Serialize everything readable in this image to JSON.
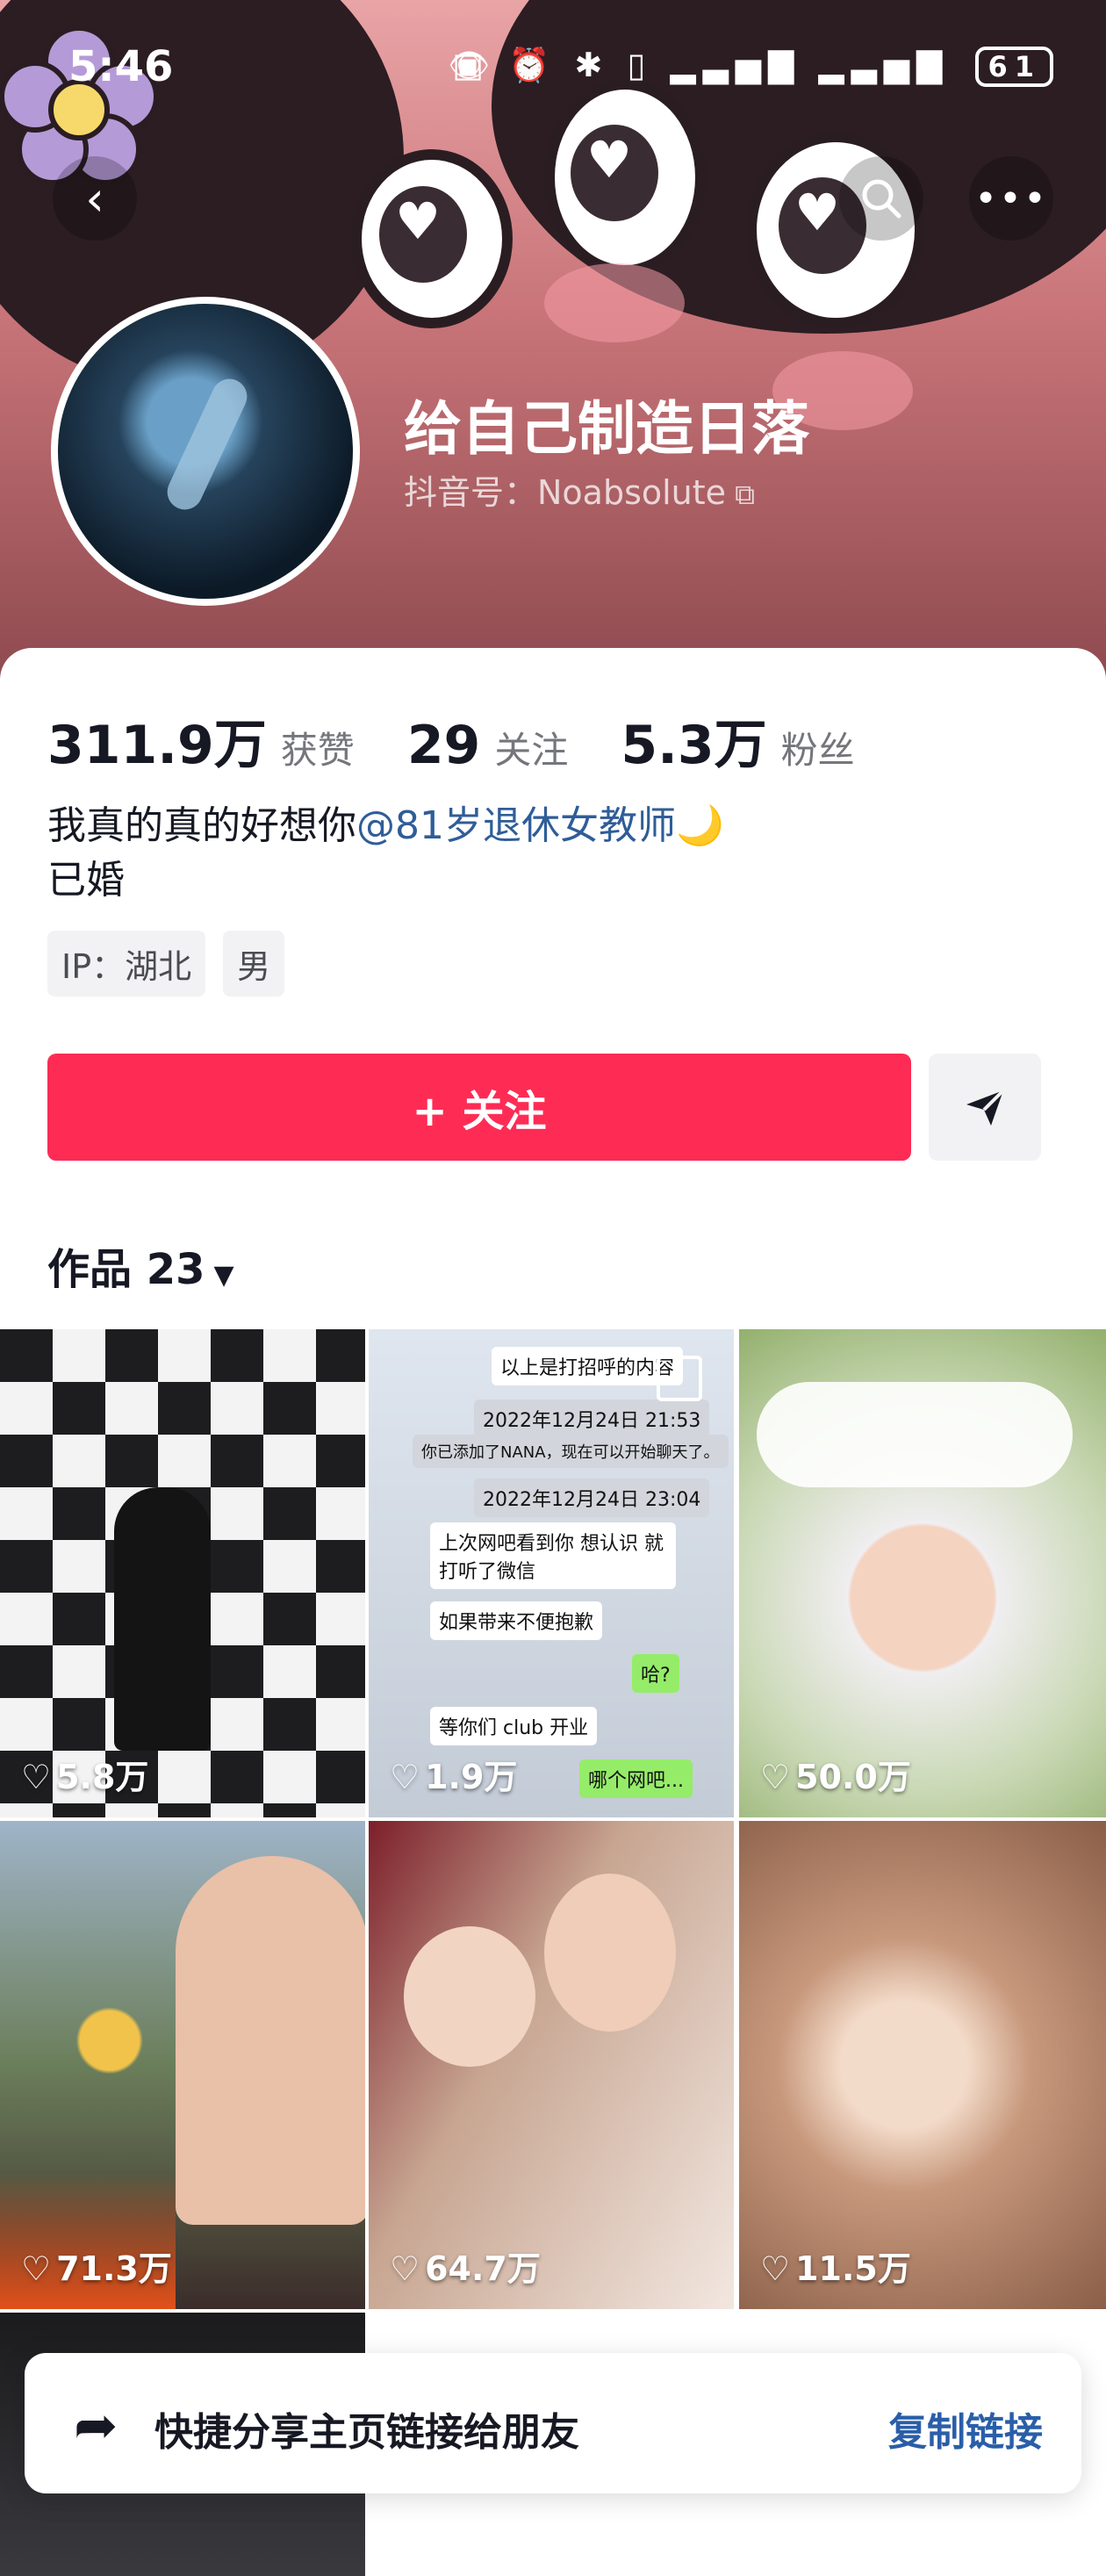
{
  "status_bar": {
    "time": "5:46",
    "battery": "61"
  },
  "profile": {
    "name": "给自己制造日落",
    "douyin_id": "抖音号：Noabsolute",
    "stats": [
      {
        "value": "311.9万",
        "label": "获赞"
      },
      {
        "value": "29",
        "label": "关注"
      },
      {
        "value": "5.3万",
        "label": "粉丝"
      }
    ],
    "bio_prefix": "我真的真的好想你",
    "bio_mention": "@81岁退休女教师",
    "bio_emoji": "🌙",
    "bio_line2": "已婚",
    "tags": [
      "IP：湖北",
      "男"
    ],
    "follow_label": "+ 关注"
  },
  "works": {
    "title": "作品 23",
    "items": [
      {
        "likes": "5.8万"
      },
      {
        "likes": "1.9万"
      },
      {
        "likes": "50.0万"
      },
      {
        "likes": "71.3万"
      },
      {
        "likes": "64.7万"
      },
      {
        "likes": "11.5万"
      }
    ],
    "chat_snippets": [
      "以上是打招呼的内容",
      "2022年12月24日 21:53",
      "你已添加了NANA，现在可以开始聊天了。",
      "2022年12月24日 23:04",
      "上次网吧看到你 想认识 就打听了微信",
      "如果带来不便抱歉",
      "哈?",
      "等你们 club 开业",
      "哪个网吧..."
    ]
  },
  "share_bar": {
    "text": "快捷分享主页链接给朋友",
    "action": "复制链接"
  },
  "colors": {
    "follow": "#fe2c55",
    "mention": "#2f5d98",
    "copy_link": "#2a5ea8"
  }
}
